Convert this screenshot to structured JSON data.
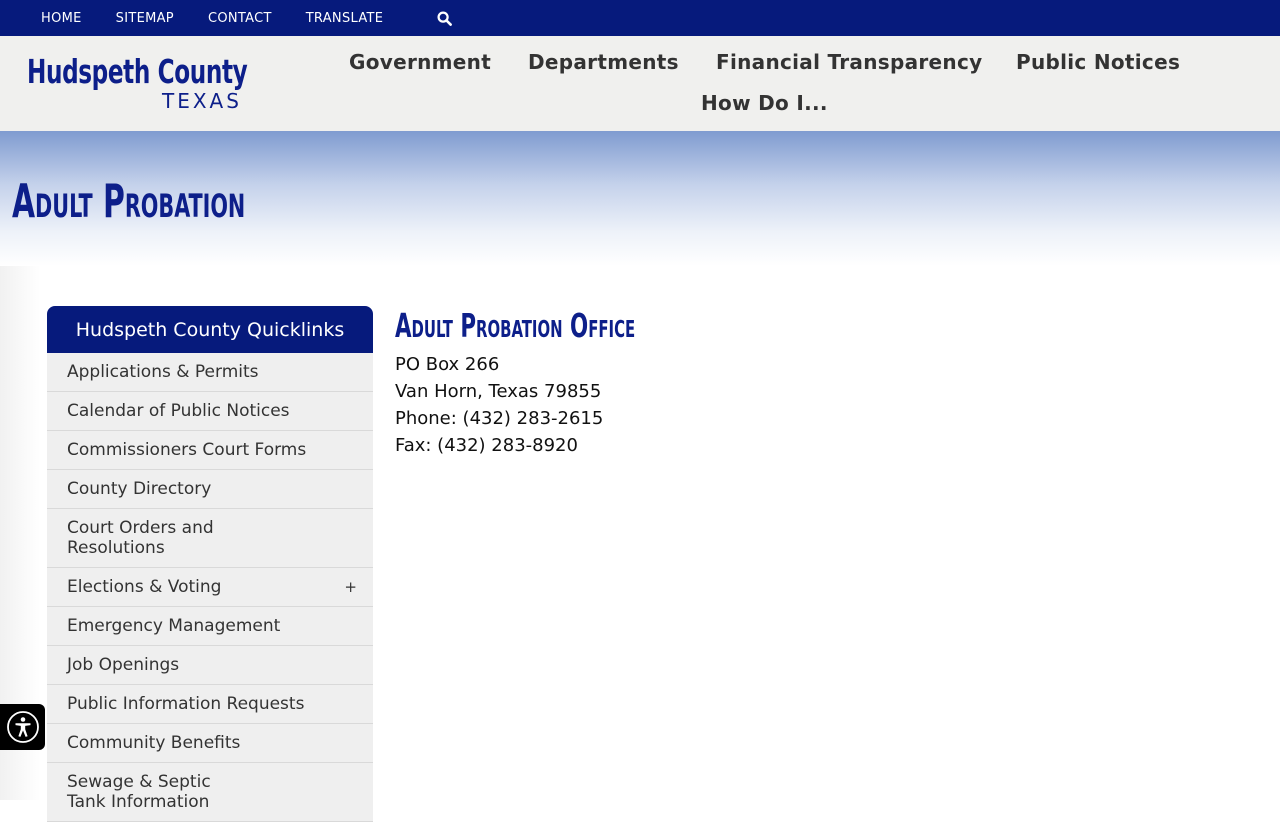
{
  "topbar": {
    "links": [
      "HOME",
      "SITEMAP",
      "CONTACT",
      "TRANSLATE"
    ],
    "search_icon": "search-icon"
  },
  "logo": {
    "line1": "Hudspeth County",
    "line2": "TEXAS"
  },
  "nav": {
    "government": "Government",
    "departments": "Departments",
    "financial": "Financial Transparency",
    "public_notices": "Public Notices",
    "how_do_i": "How Do I..."
  },
  "page": {
    "title": "Adult Probation"
  },
  "quicklinks": {
    "heading": "Hudspeth County Quicklinks",
    "items": [
      {
        "label": "Applications & Permits"
      },
      {
        "label": "Calendar of Public Notices"
      },
      {
        "label": "Commissioners Court Forms"
      },
      {
        "label": "County Directory"
      },
      {
        "label": "Court Orders and Resolutions"
      },
      {
        "label": "Elections & Voting",
        "expand": "+"
      },
      {
        "label": "Emergency Management"
      },
      {
        "label": "Job Openings"
      },
      {
        "label": "Public Information Requests"
      },
      {
        "label": "Community Benefits"
      },
      {
        "label": "Sewage & Septic Tank Information"
      }
    ]
  },
  "office": {
    "heading": "Adult Probation Office",
    "address1": "PO Box 266",
    "address2": "Van Horn, Texas 79855",
    "phone": "Phone: (432) 283-2615",
    "fax": "Fax: (432) 283-8920"
  },
  "accessibility": {
    "icon": "accessibility-icon"
  },
  "colors": {
    "brand_navy": "#061a7c",
    "title_blue": "#0d1f8a",
    "header_bg": "#f0f0ee",
    "quicklink_bg": "#efefef"
  }
}
